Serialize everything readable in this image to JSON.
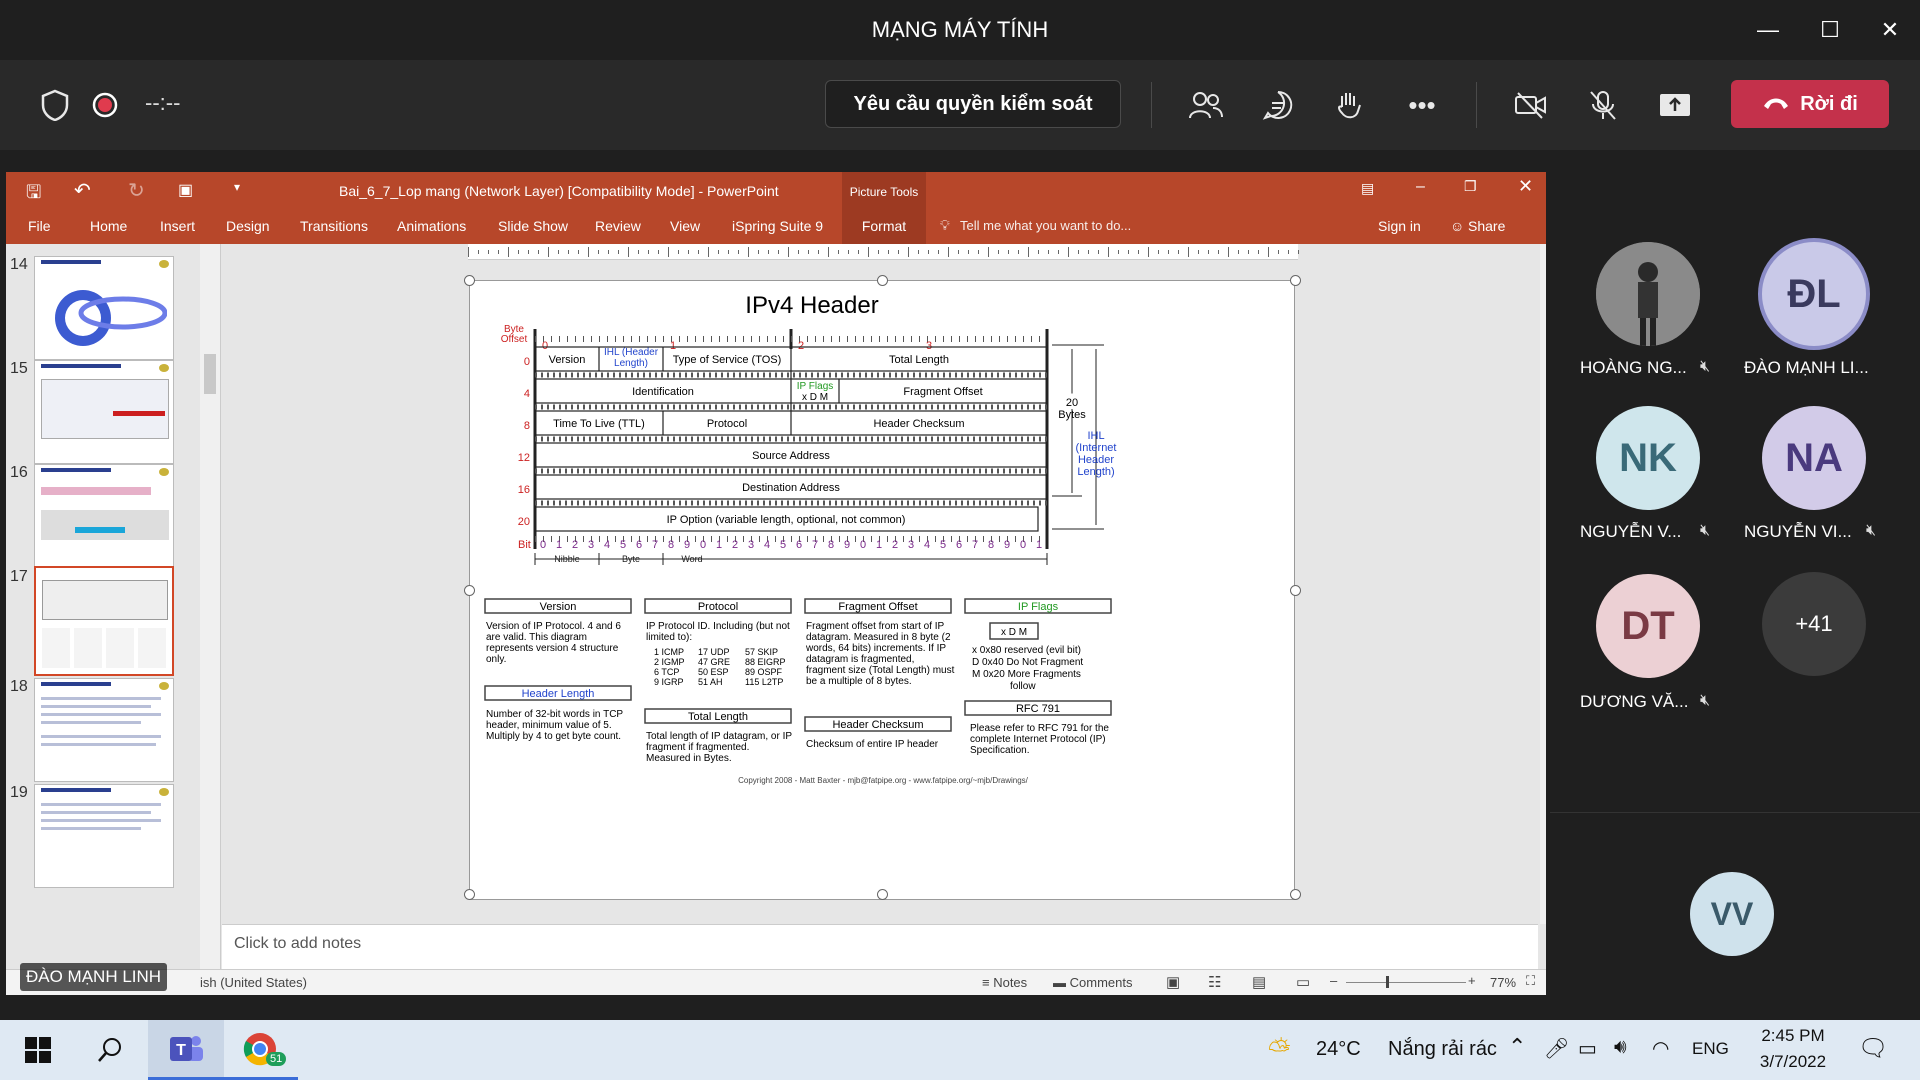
{
  "window": {
    "title": "MẠNG MÁY TÍNH"
  },
  "toolbar": {
    "timer": "--:--",
    "request_control": "Yêu cầu quyền kiểm soát",
    "leave": "Rời đi"
  },
  "ppt": {
    "doc_title": "Bai_6_7_Lop mang (Network Layer) [Compatibility Mode] - PowerPoint",
    "context_tab": "Picture Tools",
    "tabs": [
      "File",
      "Home",
      "Insert",
      "Design",
      "Transitions",
      "Animations",
      "Slide Show",
      "Review",
      "View",
      "iSpring Suite 9",
      "Format"
    ],
    "tell_me": "Tell me what you want to do...",
    "sign_in": "Sign in",
    "share": "Share",
    "thumbs": [
      {
        "num": "14"
      },
      {
        "num": "15"
      },
      {
        "num": "16"
      },
      {
        "num": "17"
      },
      {
        "num": "18"
      },
      {
        "num": "19"
      }
    ],
    "notes_placeholder": "Click to add notes",
    "status_lang": "ish (United States)",
    "status_notes": "Notes",
    "status_comments": "Comments",
    "zoom": "77%",
    "presenter_label": "ĐÀO MẠNH LINH"
  },
  "slide": {
    "title": "IPv4 Header",
    "byte_offset": "Byte\nOffset",
    "row_offsets": [
      "0",
      "4",
      "8",
      "12",
      "16",
      "20"
    ],
    "bit_marks": [
      "0",
      "1",
      "2",
      "3"
    ],
    "fields": {
      "version": "Version",
      "ihl": "IHL (Header Length)",
      "tos": "Type of Service (TOS)",
      "total_length": "Total Length",
      "identification": "Identification",
      "ip_flags": "IP Flags",
      "xdm": "x  D  M",
      "fragment_offset": "Fragment Offset",
      "ttl": "Time To Live (TTL)",
      "protocol": "Protocol",
      "header_checksum": "Header Checksum",
      "source": "Source Address",
      "destination": "Destination Address",
      "options": "IP Option (variable length, optional, not common)"
    },
    "side_20": "20\nBytes",
    "side_ihl": "IHL\n(Internet\nHeader\nLength)",
    "bit_label": "Bit",
    "nibble": "Nibble",
    "byte": "Byte",
    "word": "Word",
    "desc": {
      "version_h": "Version",
      "version_t": "Version of IP Protocol.  4 and 6 are valid.  This diagram represents version 4 structure only.",
      "hl_h": "Header Length",
      "hl_t": "Number of 32-bit words in TCP header, minimum value of 5.  Multiply by 4 to get byte count.",
      "proto_h": "Protocol",
      "proto_t": "IP Protocol ID.  Including (but not limited to):",
      "proto_list": [
        "1 ICMP",
        "2 IGMP",
        "6 TCP",
        "9 IGRP",
        "17 UDP",
        "47 GRE",
        "50 ESP",
        "51 AH",
        "57 SKIP",
        "88 EIGRP",
        "89 OSPF",
        "115 L2TP"
      ],
      "tl_h": "Total Length",
      "tl_t": "Total length of IP datagram, or IP fragment if fragmented.  Measured in Bytes.",
      "fo_h": "Fragment Offset",
      "fo_t": "Fragment offset from start of IP datagram.  Measured in 8 byte (2 words, 64 bits) increments.  If IP datagram is fragmented, fragment size (Total Length) must be a multiple of 8 bytes.",
      "hc_h": "Header Checksum",
      "hc_t": "Checksum of entire IP header",
      "flags_h": "IP Flags",
      "flags_box": "x  D  M",
      "flags_list": [
        "x  0x80 reserved (evil bit)",
        "D  0x40 Do Not Fragment",
        "M  0x20 More Fragments",
        "follow"
      ],
      "rfc_h": "RFC 791",
      "rfc_t": "Please refer to RFC 791 for the complete Internet Protocol (IP) Specification."
    },
    "copyright": "Copyright 2008 - Matt Baxter - mjb@fatpipe.org - www.fatpipe.org/~mjb/Drawings/"
  },
  "participants": [
    {
      "initials": "",
      "name": "HOÀNG NG...",
      "muted": true,
      "color": "#777777"
    },
    {
      "initials": "ĐL",
      "name": "ĐÀO MẠNH LI...",
      "muted": false,
      "color": "#c9c9e8"
    },
    {
      "initials": "NK",
      "name": "NGUYỄN V...",
      "muted": true,
      "color": "#cfe6ec"
    },
    {
      "initials": "NA",
      "name": "NGUYỄN VI...",
      "muted": true,
      "color": "#d2cbe8"
    },
    {
      "initials": "DT",
      "name": "DƯƠNG VĂ...",
      "muted": true,
      "color": "#ecd0d4"
    },
    {
      "initials": "+41",
      "name": "",
      "muted": false,
      "color": "#3b3b3b"
    },
    {
      "initials": "VV",
      "name": "",
      "muted": false,
      "color": "#cfe2ec"
    }
  ],
  "taskbar": {
    "temp": "24°C",
    "weather": "Nắng rải rác",
    "lang": "ENG",
    "time": "2:45 PM",
    "date": "3/7/2022",
    "chrome_badge": "51"
  }
}
